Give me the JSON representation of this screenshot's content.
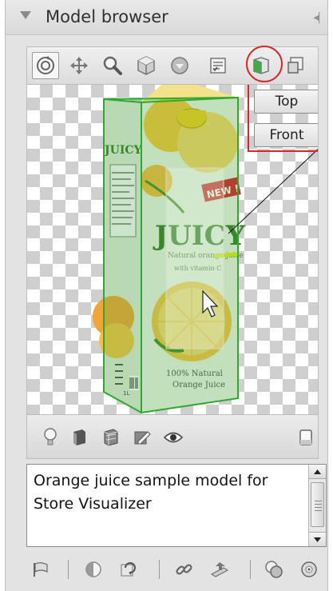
{
  "panel": {
    "title": "Model browser",
    "collapse_glyph": "◂|"
  },
  "toolbar": {
    "tools": [
      {
        "name": "orbit-icon",
        "active": true
      },
      {
        "name": "pan-icon"
      },
      {
        "name": "zoom-icon"
      },
      {
        "name": "cube-icon"
      },
      {
        "name": "sphere-icon"
      },
      {
        "name": "settings-list-icon"
      },
      {
        "name": "front-view-toggle-icon",
        "highlighted": true
      },
      {
        "name": "box-edit-icon"
      }
    ]
  },
  "viewport": {
    "top_button": "Top",
    "front_button": "Front",
    "highlight_color": "#d9262c",
    "bbox_color": "#2ea82e"
  },
  "model": {
    "brand": "JUICY",
    "side_brand": "JUICY",
    "new_badge": "NEW !",
    "tagline": "Natural orange juice",
    "subline": "with vitamin C",
    "footer_line1": "100% Natural",
    "footer_line2": "Orange Juice",
    "volume": "1L"
  },
  "viewport_toolbar": {
    "tools": [
      "light-icon",
      "shading-icon",
      "wireframe-icon",
      "edit-icon",
      "eye-icon",
      "background-icon"
    ]
  },
  "description": {
    "text": "Orange juice sample model for Store Visualizer"
  },
  "bottom_toolbar": {
    "tools": [
      "flag-icon",
      "contrast-icon",
      "refresh-icon",
      "link-icon",
      "export-icon",
      "layers-icon",
      "globe-icon"
    ]
  }
}
